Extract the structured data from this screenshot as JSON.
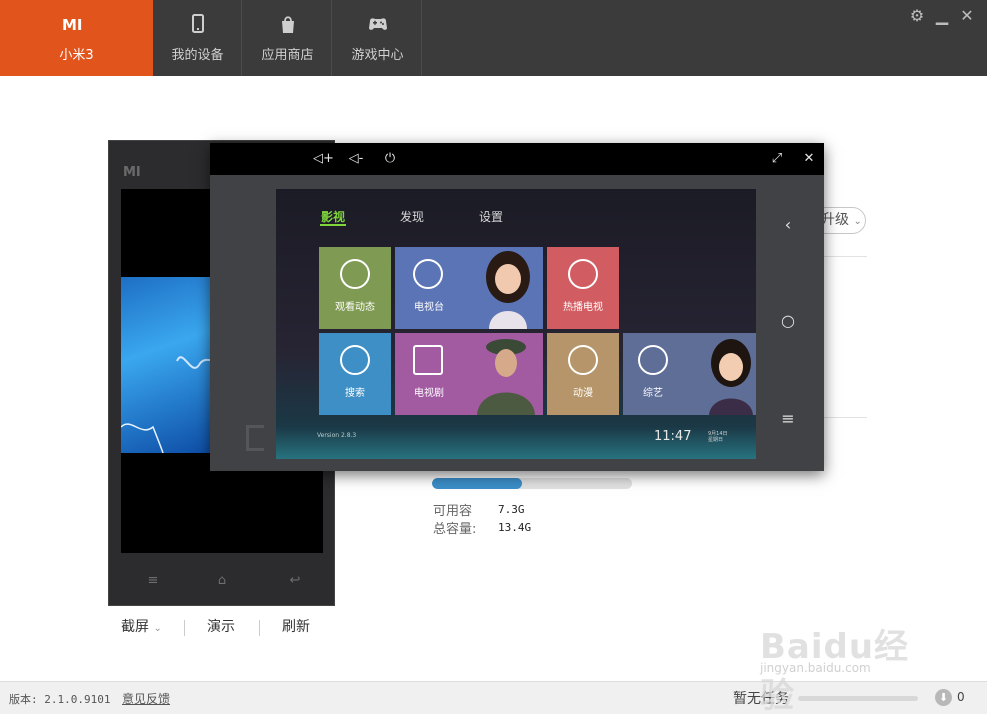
{
  "brand": {
    "logo": "MI",
    "device_name": "小米3",
    "color": "#e1541c"
  },
  "tabs": [
    {
      "label": "我的设备",
      "icon": "phone-icon"
    },
    {
      "label": "应用商店",
      "icon": "bag-icon"
    },
    {
      "label": "游戏中心",
      "icon": "gamepad-icon"
    }
  ],
  "window_controls": {
    "settings": "settings-gear-icon",
    "minimize": "minimize-icon",
    "close": "close-icon"
  },
  "phone": {
    "logo": "MI",
    "nav_icons": [
      "menu-icon",
      "home-icon",
      "back-icon"
    ],
    "actions": {
      "screenshot": "截屏",
      "demo": "演示",
      "refresh": "刷新"
    }
  },
  "storage": {
    "button_partial": "升级",
    "used_fraction": 0.45,
    "available_label": "可用容",
    "available_value": "7.3G",
    "total_label": "总容量:",
    "total_value": "13.4G",
    "bar_color": "#3c8fc9"
  },
  "projection": {
    "title_controls": [
      "volume-up-icon",
      "volume-down-icon",
      "power-icon",
      "fullscreen-icon",
      "close-icon"
    ],
    "tv": {
      "menu": [
        "影视",
        "发现",
        "设置"
      ],
      "active_menu": "影视",
      "tiles": [
        {
          "label": "观看动态",
          "color": "#7f9a52"
        },
        {
          "label": "电视台",
          "color": "#5a74b5"
        },
        {
          "label": "热播电视",
          "color": "#d15d62"
        },
        {
          "label": "搜索",
          "color": "#3d8fc6"
        },
        {
          "label": "电视剧",
          "color": "#a25aa1"
        },
        {
          "label": "动漫",
          "color": "#b6956a"
        },
        {
          "label": "综艺",
          "color": "#5e6e97"
        }
      ],
      "version": "Version 2.8.3",
      "time": "11:47",
      "date_line1": "9月14日",
      "date_line2": "星期日"
    },
    "side_buttons": [
      "back-arrow-icon",
      "home-circle-icon",
      "menu-lines-icon"
    ]
  },
  "status": {
    "version": "版本: 2.1.0.9101",
    "feedback": "意见反馈",
    "task": "暂无任务",
    "download_count": "0"
  },
  "watermark": {
    "big": "Baidu经验",
    "small": "jingyan.baidu.com"
  }
}
